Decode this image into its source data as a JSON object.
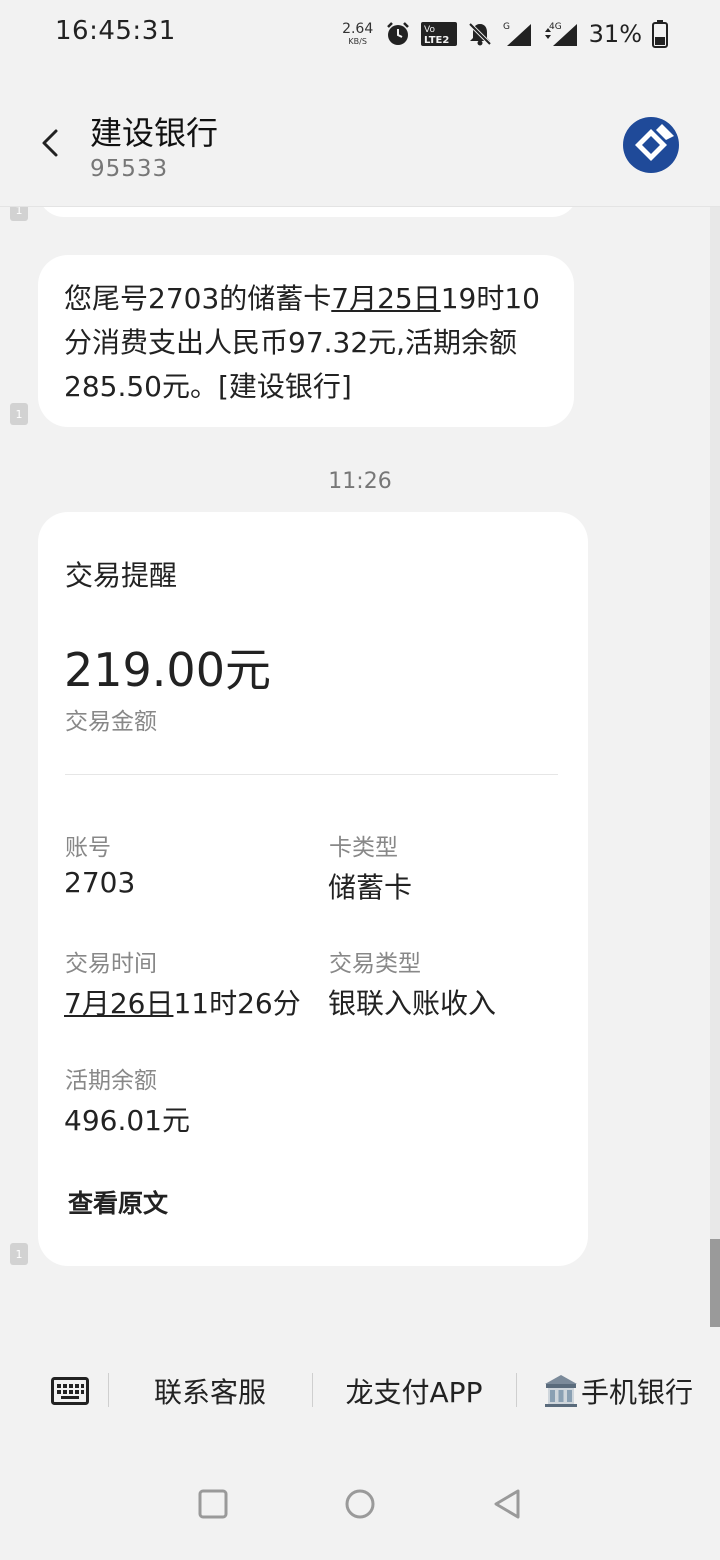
{
  "status_bar": {
    "time": "16:45:31",
    "net_speed_value": "2.64",
    "net_speed_unit": "KB/S",
    "volte_label": "Vo LTE2",
    "signal_1_type": "G",
    "signal_2_type": "4G",
    "battery": "31%",
    "icons": [
      "alarm-icon",
      "volte-icon",
      "mute-bell-icon",
      "signal-icon",
      "signal-icon",
      "battery-icon"
    ]
  },
  "header": {
    "contact_name": "建设银行",
    "contact_number": "95533",
    "logo": "ccb-logo",
    "accent_color": "#1f4a99"
  },
  "messages": {
    "sim_badge": "1",
    "sms": {
      "part1": "您尾号2703的储蓄卡",
      "date_link": "7月25日",
      "part2": "19时10分消费支出人民币97.32元,活期余额285.50元。[建设银行]"
    },
    "time_separator": "11:26",
    "card": {
      "title": "交易提醒",
      "amount": "219.00元",
      "amount_label": "交易金额",
      "account_label": "账号",
      "account_value": "2703",
      "card_type_label": "卡类型",
      "card_type_value": "储蓄卡",
      "trade_time_label": "交易时间",
      "trade_time_date": "7月26日",
      "trade_time_rest": "11时26分",
      "trade_type_label": "交易类型",
      "trade_type_value": "银联入账收入",
      "balance_label": "活期余额",
      "balance_value": "496.01元",
      "view_original": "查看原文"
    }
  },
  "menu": {
    "keyboard_icon": "keyboard-icon",
    "item1": "联系客服",
    "item2": "龙支付APP",
    "item3_icon": "bank-icon",
    "item3": "手机银行"
  },
  "nav": {
    "icons": [
      "recent-apps-icon",
      "home-icon",
      "back-triangle-icon"
    ]
  }
}
